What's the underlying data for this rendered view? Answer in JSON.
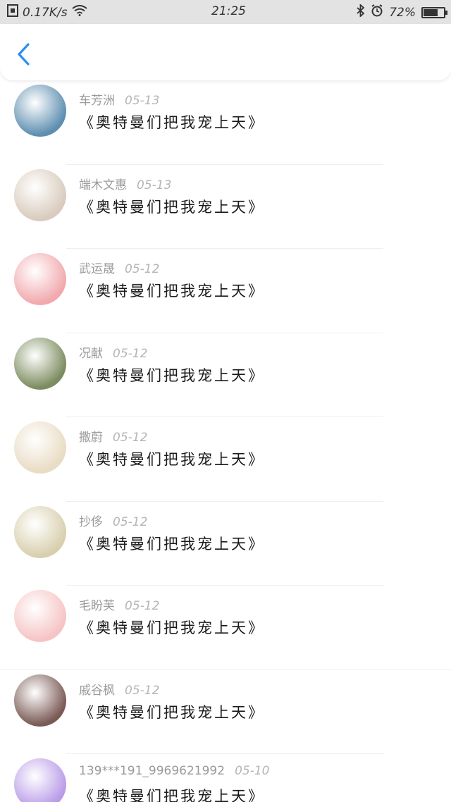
{
  "status_bar": {
    "network_speed": "0.17K/s",
    "time": "21:25",
    "battery_text": "72%",
    "battery_level": 0.72
  },
  "colors": {
    "accent": "#2a8ff0",
    "status_bar_bg": "#e3e3e3"
  },
  "nav": {
    "back_icon": "chevron-left-icon"
  },
  "messages": [
    {
      "name": "车芳洲",
      "date": "05-13",
      "text": "《奥特曼们把我宠上天》",
      "avatar_color": "#5e8fb0"
    },
    {
      "name": "端木文惠",
      "date": "05-13",
      "text": "《奥特曼们把我宠上天》",
      "avatar_color": "#d9cbbd"
    },
    {
      "name": "武运晟",
      "date": "05-12",
      "text": "《奥特曼们把我宠上天》",
      "avatar_color": "#f1a9ad"
    },
    {
      "name": "况献",
      "date": "05-12",
      "text": "《奥特曼们把我宠上天》",
      "avatar_color": "#7c8c5f"
    },
    {
      "name": "撒蔚",
      "date": "05-12",
      "text": "《奥特曼们把我宠上天》",
      "avatar_color": "#e9dcc4"
    },
    {
      "name": "抄侈",
      "date": "05-12",
      "text": "《奥特曼们把我宠上天》",
      "avatar_color": "#d8cfae"
    },
    {
      "name": "毛盼芙",
      "date": "05-12",
      "text": "《奥特曼们把我宠上天》",
      "avatar_color": "#f6c4c4"
    },
    {
      "name": "戚谷枫",
      "date": "05-12",
      "text": "《奥特曼们把我宠上天》",
      "avatar_color": "#7a5a55"
    },
    {
      "name": "139***191_9969621992",
      "date": "05-10",
      "text": "《奥特曼们把我宠上天》",
      "avatar_color": "#b99be8"
    }
  ]
}
